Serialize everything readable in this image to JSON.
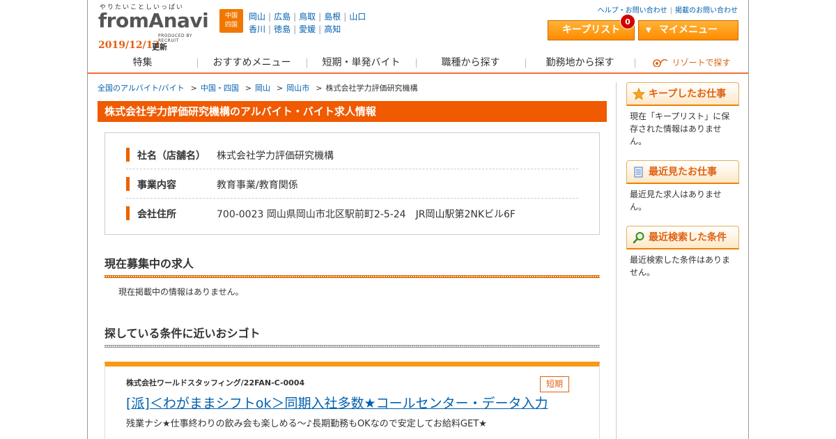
{
  "header": {
    "logo_tagline": "やりたいことしいっぱい",
    "logo_text_a": "from",
    "logo_text_b": "A",
    "logo_text_c": "navi",
    "logo_produced": "PRODUCED BY RECRUIT",
    "update_date": "2019/12/12",
    "update_label": "更新",
    "region_badge_line1": "中国",
    "region_badge_line2": "四国",
    "region_row1": [
      "岡山",
      "広島",
      "鳥取",
      "島根",
      "山口"
    ],
    "region_row2": [
      "香川",
      "徳島",
      "愛媛",
      "高知"
    ],
    "top_links": [
      "ヘルプ・お問い合わせ",
      "掲載のお問い合わせ"
    ],
    "keep_button": "キープリスト",
    "keep_count": "0",
    "mymenu_button": "マイメニュー",
    "accent_color": "#f05a00"
  },
  "nav": {
    "items": [
      "特集",
      "おすすめメニュー",
      "短期・単発バイト",
      "職種から探す",
      "勤務地から探す",
      "リゾートで探す"
    ]
  },
  "breadcrumb": {
    "items": [
      "全国のアルバイト/バイト",
      "中国・四国",
      "岡山",
      "岡山市"
    ],
    "current": "株式会社学力評価研究機構"
  },
  "page_title": "株式会社学力評価研究機構のアルバイト・バイト求人情報",
  "company": {
    "rows": [
      {
        "label": "社名（店舗名）",
        "value": "株式会社学力評価研究機構"
      },
      {
        "label": "事業内容",
        "value": "教育事業/教育関係"
      },
      {
        "label": "会社住所",
        "value": "700-0023 岡山県岡山市北区駅前町2-5-24　JR岡山駅第2NKビル6F"
      }
    ]
  },
  "recruiting": {
    "title": "現在募集中の求人",
    "empty_text": "現在掲載中の情報はありません。"
  },
  "similar": {
    "title": "探している条件に近いおシゴト",
    "job": {
      "company": "株式会社ワールドスタッフィング/22FAN-C-0004",
      "tag": "短期",
      "title": "[派]＜わがままシフトok＞同期入社多数★コールセンター・データ入力",
      "description": "残業ナシ★仕事終わりの飲み会も楽しめる～♪長期勤務もOKなので安定してお給料GET★"
    }
  },
  "sidebar": {
    "boxes": [
      {
        "title": "キープしたお仕事",
        "icon": "star-icon",
        "body": "現在「キープリスト」に保存された情報はありません。"
      },
      {
        "title": "最近見たお仕事",
        "icon": "document-icon",
        "body": "最近見た求人はありません。"
      },
      {
        "title": "最近検索した条件",
        "icon": "search-icon",
        "body": "最近検索した条件はありません。"
      }
    ]
  }
}
